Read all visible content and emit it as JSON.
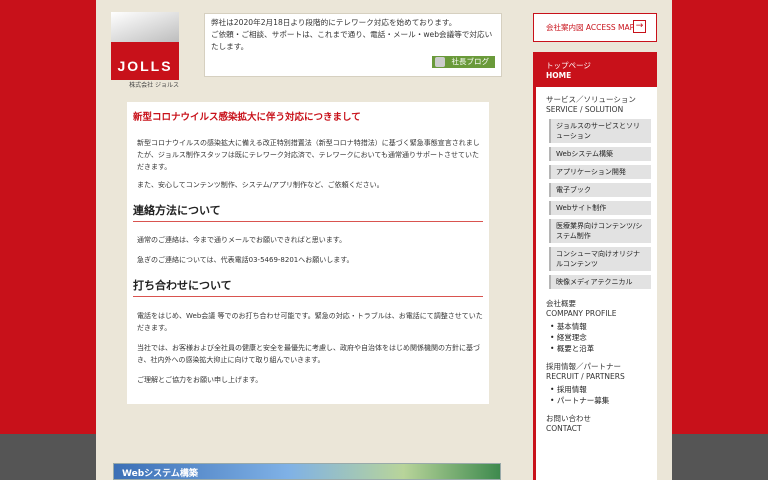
{
  "logo": {
    "wordmark": "JOLLS",
    "subtext": "株式会社 ジョルス"
  },
  "notice": {
    "line1": "弊社は2020年2月18日より段階的にテレワーク対応を始めております。",
    "line2": "ご依頼・ご相談、サポートは、これまで通り、電話・メール・web会議等で対応いたします。",
    "blog_button": "社長ブログ"
  },
  "content": {
    "title": "新型コロナウイルス感染拡大に伴う対応につきまして",
    "intro": "新型コロナウイルスの感染拡大に備える改正特別措置法（新型コロナ特措法）に基づく緊急事態宣言されましたが、ジョルス制作スタッフは既にテレワーク対応済で、テレワークにおいても通常通りサポートさせていただきます。",
    "intro2": "また、安心してコンテンツ制作、システム/アプリ制作など、ご依頼ください。",
    "contact_heading": "連絡方法について",
    "contact_p1": "通常のご連絡は、今まで通りメールでお願いできればと思います。",
    "contact_p2": "急ぎのご連絡については、代表電話03-5469-8201へお願いします。",
    "meeting_heading": "打ち合わせについて",
    "meeting_p1": "電話をはじめ、Web会議 等でのお打ち合わせ可能です。緊急の対応・トラブルは、お電話にて調整させていただきます。",
    "meeting_p2": "当社では、お客様および全社員の健康と安全を最優先に考慮し、政府や自治体をはじめ関係機関の方針に基づき、社内外への感染拡大抑止に向けて取り組んでいきます。",
    "meeting_p3": "ご理解とご協力をお願い申し上げます。"
  },
  "banner": {
    "label": "Webシステム構築"
  },
  "sidebar": {
    "access_label": "会社案内図 ACCESS MAP",
    "home_ja": "トップページ",
    "home_en": "HOME",
    "service_ja": "サービス／ソリューション",
    "service_en": "SERVICE / SOLUTION",
    "services": [
      "ジョルスのサービスとソリューション",
      "Webシステム構築",
      "アプリケーション開発",
      "電子ブック",
      "Webサイト制作",
      "医療業界向けコンテンツ/システム制作",
      "コンシューマ向けオリジナルコンテンツ",
      "映像メディアテクニカル"
    ],
    "company_ja": "会社概要",
    "company_en": "COMPANY PROFILE",
    "company_items": [
      "基本情報",
      "経営理念",
      "概要と沿革"
    ],
    "recruit_ja": "採用情報／パートナー",
    "recruit_en": "RECRUIT / PARTNERS",
    "recruit_items": [
      "採用情報",
      "パートナー募集"
    ],
    "contact_ja": "お問い合わせ",
    "contact_en": "CONTACT"
  },
  "colors": {
    "brand_red": "#c8111a",
    "page_bg": "#ebe6d8",
    "blog_green": "#6a9a3a"
  }
}
